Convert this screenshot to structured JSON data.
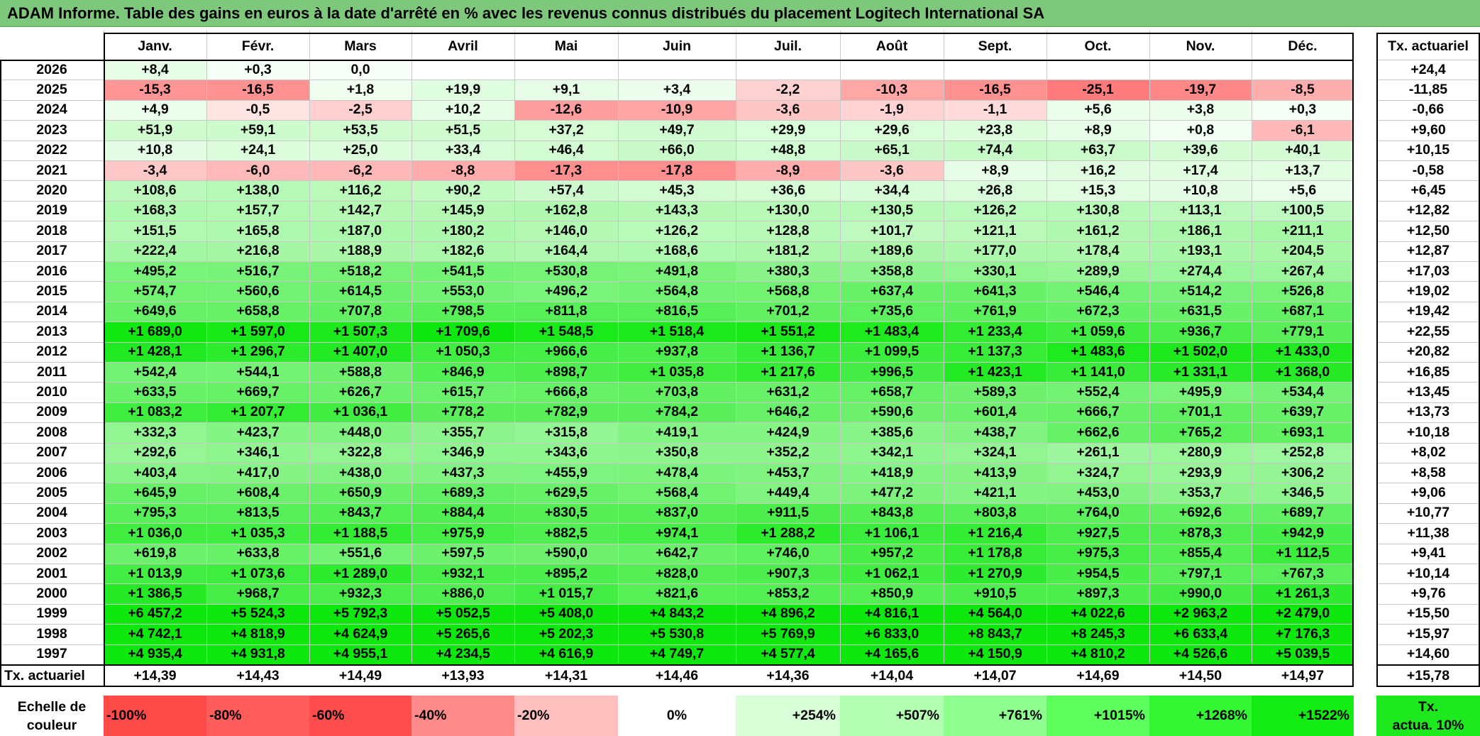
{
  "title": "ADAM Informe. Table des gains en euros à la date d'arrêté en % avec les revenus connus distribués du placement Logitech International SA",
  "months": [
    "Janv.",
    "Févr.",
    "Mars",
    "Avril",
    "Mai",
    "Juin",
    "Juil.",
    "Août",
    "Sept.",
    "Oct.",
    "Nov.",
    "Déc."
  ],
  "rate_header": "Tx. actuariel",
  "rows": [
    {
      "year": "2026",
      "values": [
        "+8,4",
        "+0,3",
        "0,0",
        "",
        "",
        "",
        "",
        "",
        "",
        "",
        "",
        ""
      ],
      "rate": "+24,4"
    },
    {
      "year": "2025",
      "values": [
        "-15,3",
        "-16,5",
        "+1,8",
        "+19,9",
        "+9,1",
        "+3,4",
        "-2,2",
        "-10,3",
        "-16,5",
        "-25,1",
        "-19,7",
        "-8,5"
      ],
      "rate": "-11,85"
    },
    {
      "year": "2024",
      "values": [
        "+4,9",
        "-0,5",
        "-2,5",
        "+10,2",
        "-12,6",
        "-10,9",
        "-3,6",
        "-1,9",
        "-1,1",
        "+5,6",
        "+3,8",
        "+0,3"
      ],
      "rate": "-0,66"
    },
    {
      "year": "2023",
      "values": [
        "+51,9",
        "+59,1",
        "+53,5",
        "+51,5",
        "+37,2",
        "+49,7",
        "+29,9",
        "+29,6",
        "+23,8",
        "+8,9",
        "+0,8",
        "-6,1"
      ],
      "rate": "+9,60"
    },
    {
      "year": "2022",
      "values": [
        "+10,8",
        "+24,1",
        "+25,0",
        "+33,4",
        "+46,4",
        "+66,0",
        "+48,8",
        "+65,1",
        "+74,4",
        "+63,7",
        "+39,6",
        "+40,1"
      ],
      "rate": "+10,15"
    },
    {
      "year": "2021",
      "values": [
        "-3,4",
        "-6,0",
        "-6,2",
        "-8,8",
        "-17,3",
        "-17,8",
        "-8,9",
        "-3,6",
        "+8,9",
        "+16,2",
        "+17,4",
        "+13,7"
      ],
      "rate": "-0,58"
    },
    {
      "year": "2020",
      "values": [
        "+108,6",
        "+138,0",
        "+116,2",
        "+90,2",
        "+57,4",
        "+45,3",
        "+36,6",
        "+34,4",
        "+26,8",
        "+15,3",
        "+10,8",
        "+5,6"
      ],
      "rate": "+6,45"
    },
    {
      "year": "2019",
      "values": [
        "+168,3",
        "+157,7",
        "+142,7",
        "+145,9",
        "+162,8",
        "+143,3",
        "+130,0",
        "+130,5",
        "+126,2",
        "+130,8",
        "+113,1",
        "+100,5"
      ],
      "rate": "+12,82"
    },
    {
      "year": "2018",
      "values": [
        "+151,5",
        "+165,8",
        "+187,0",
        "+180,2",
        "+146,0",
        "+126,2",
        "+128,8",
        "+101,7",
        "+121,1",
        "+161,2",
        "+186,1",
        "+211,1"
      ],
      "rate": "+12,50"
    },
    {
      "year": "2017",
      "values": [
        "+222,4",
        "+216,8",
        "+188,9",
        "+182,6",
        "+164,4",
        "+168,6",
        "+181,2",
        "+189,6",
        "+177,0",
        "+178,4",
        "+193,1",
        "+204,5"
      ],
      "rate": "+12,87"
    },
    {
      "year": "2016",
      "values": [
        "+495,2",
        "+516,7",
        "+518,2",
        "+541,5",
        "+530,8",
        "+491,8",
        "+380,3",
        "+358,8",
        "+330,1",
        "+289,9",
        "+274,4",
        "+267,4"
      ],
      "rate": "+17,03"
    },
    {
      "year": "2015",
      "values": [
        "+574,7",
        "+560,6",
        "+614,5",
        "+553,0",
        "+496,2",
        "+564,8",
        "+568,8",
        "+637,4",
        "+641,3",
        "+546,4",
        "+514,2",
        "+526,8"
      ],
      "rate": "+19,02"
    },
    {
      "year": "2014",
      "values": [
        "+649,6",
        "+658,8",
        "+707,8",
        "+798,5",
        "+811,8",
        "+816,5",
        "+701,2",
        "+735,6",
        "+761,9",
        "+672,3",
        "+631,5",
        "+687,1"
      ],
      "rate": "+19,42"
    },
    {
      "year": "2013",
      "values": [
        "+1 689,0",
        "+1 597,0",
        "+1 507,3",
        "+1 709,6",
        "+1 548,5",
        "+1 518,4",
        "+1 551,2",
        "+1 483,4",
        "+1 233,4",
        "+1 059,6",
        "+936,7",
        "+779,1"
      ],
      "rate": "+22,55"
    },
    {
      "year": "2012",
      "values": [
        "+1 428,1",
        "+1 296,7",
        "+1 407,0",
        "+1 050,3",
        "+966,6",
        "+937,8",
        "+1 136,7",
        "+1 099,5",
        "+1 137,3",
        "+1 483,6",
        "+1 502,0",
        "+1 433,0"
      ],
      "rate": "+20,82"
    },
    {
      "year": "2011",
      "values": [
        "+542,4",
        "+544,1",
        "+588,8",
        "+846,9",
        "+898,7",
        "+1 035,8",
        "+1 217,6",
        "+996,5",
        "+1 423,1",
        "+1 141,0",
        "+1 331,1",
        "+1 368,0"
      ],
      "rate": "+16,85"
    },
    {
      "year": "2010",
      "values": [
        "+633,5",
        "+669,7",
        "+626,7",
        "+615,7",
        "+666,8",
        "+703,8",
        "+631,2",
        "+658,7",
        "+589,3",
        "+552,4",
        "+495,9",
        "+534,4"
      ],
      "rate": "+13,45"
    },
    {
      "year": "2009",
      "values": [
        "+1 083,2",
        "+1 207,7",
        "+1 036,1",
        "+778,2",
        "+782,9",
        "+784,2",
        "+646,2",
        "+590,6",
        "+601,4",
        "+666,7",
        "+701,1",
        "+639,7"
      ],
      "rate": "+13,73"
    },
    {
      "year": "2008",
      "values": [
        "+332,3",
        "+423,7",
        "+448,0",
        "+355,7",
        "+315,8",
        "+419,1",
        "+424,9",
        "+385,6",
        "+438,7",
        "+662,6",
        "+765,2",
        "+693,1"
      ],
      "rate": "+10,18"
    },
    {
      "year": "2007",
      "values": [
        "+292,6",
        "+346,1",
        "+322,8",
        "+346,9",
        "+343,6",
        "+350,8",
        "+352,2",
        "+342,1",
        "+324,1",
        "+261,1",
        "+280,9",
        "+252,8"
      ],
      "rate": "+8,02"
    },
    {
      "year": "2006",
      "values": [
        "+403,4",
        "+417,0",
        "+438,0",
        "+437,3",
        "+455,9",
        "+478,4",
        "+453,7",
        "+418,9",
        "+413,9",
        "+324,7",
        "+293,9",
        "+306,2"
      ],
      "rate": "+8,58"
    },
    {
      "year": "2005",
      "values": [
        "+645,9",
        "+608,4",
        "+650,9",
        "+689,3",
        "+629,5",
        "+568,4",
        "+449,4",
        "+477,2",
        "+421,1",
        "+453,0",
        "+353,7",
        "+346,5"
      ],
      "rate": "+9,06"
    },
    {
      "year": "2004",
      "values": [
        "+795,3",
        "+813,5",
        "+843,7",
        "+884,4",
        "+830,5",
        "+837,0",
        "+911,5",
        "+843,8",
        "+803,8",
        "+764,0",
        "+692,6",
        "+689,7"
      ],
      "rate": "+10,77"
    },
    {
      "year": "2003",
      "values": [
        "+1 036,0",
        "+1 035,3",
        "+1 188,5",
        "+975,9",
        "+882,5",
        "+974,1",
        "+1 288,2",
        "+1 106,1",
        "+1 216,4",
        "+927,5",
        "+878,3",
        "+942,9"
      ],
      "rate": "+11,38"
    },
    {
      "year": "2002",
      "values": [
        "+619,8",
        "+633,8",
        "+551,6",
        "+597,5",
        "+590,0",
        "+642,7",
        "+746,0",
        "+957,2",
        "+1 178,8",
        "+975,3",
        "+855,4",
        "+1 112,5"
      ],
      "rate": "+9,41"
    },
    {
      "year": "2001",
      "values": [
        "+1 013,9",
        "+1 073,6",
        "+1 289,0",
        "+932,1",
        "+895,2",
        "+828,0",
        "+907,3",
        "+1 062,1",
        "+1 270,9",
        "+954,5",
        "+797,1",
        "+767,3"
      ],
      "rate": "+10,14"
    },
    {
      "year": "2000",
      "values": [
        "+1 386,5",
        "+968,7",
        "+932,3",
        "+886,0",
        "+1 015,7",
        "+821,6",
        "+853,2",
        "+850,9",
        "+910,5",
        "+897,3",
        "+990,0",
        "+1 261,3"
      ],
      "rate": "+9,76"
    },
    {
      "year": "1999",
      "values": [
        "+6 457,2",
        "+5 524,3",
        "+5 792,3",
        "+5 052,5",
        "+5 408,0",
        "+4 843,2",
        "+4 896,2",
        "+4 816,1",
        "+4 564,0",
        "+4 022,6",
        "+2 963,2",
        "+2 479,0"
      ],
      "rate": "+15,50"
    },
    {
      "year": "1998",
      "values": [
        "+4 742,1",
        "+4 818,9",
        "+4 624,9",
        "+5 265,6",
        "+5 202,3",
        "+5 530,8",
        "+5 769,9",
        "+6 833,0",
        "+8 843,7",
        "+8 245,3",
        "+6 633,4",
        "+7 176,3"
      ],
      "rate": "+15,97"
    },
    {
      "year": "1997",
      "values": [
        "+4 935,4",
        "+4 931,8",
        "+4 955,1",
        "+4 234,5",
        "+4 616,9",
        "+4 749,7",
        "+4 577,4",
        "+4 165,6",
        "+4 150,9",
        "+4 810,2",
        "+4 526,6",
        "+5 039,5"
      ],
      "rate": "+14,60"
    }
  ],
  "footer": {
    "label": "Tx. actuariel",
    "values": [
      "+14,39",
      "+14,43",
      "+14,49",
      "+13,93",
      "+14,31",
      "+14,46",
      "+14,36",
      "+14,04",
      "+14,07",
      "+14,69",
      "+14,50",
      "+14,97"
    ],
    "rate": "+15,78"
  },
  "scale": {
    "label_line1": "Echelle de",
    "label_line2": "couleur",
    "steps": [
      {
        "text": "-100%",
        "color": "#ff4a4a",
        "align": "left"
      },
      {
        "text": "-80%",
        "color": "#ff5c5c",
        "align": "left"
      },
      {
        "text": "-60%",
        "color": "#ff4d4d",
        "align": "left"
      },
      {
        "text": "-40%",
        "color": "#ff8a8a",
        "align": "left"
      },
      {
        "text": "-20%",
        "color": "#ffbfbf",
        "align": "left"
      },
      {
        "text": "0%",
        "color": "#ffffff",
        "align": "center"
      },
      {
        "text": "+254%",
        "color": "#d8ffd8",
        "align": "right"
      },
      {
        "text": "+507%",
        "color": "#b4ffb4",
        "align": "right"
      },
      {
        "text": "+761%",
        "color": "#8eff8e",
        "align": "right"
      },
      {
        "text": "+1015%",
        "color": "#5cff5c",
        "align": "right"
      },
      {
        "text": "+1268%",
        "color": "#33f733",
        "align": "right"
      },
      {
        "text": "+1522%",
        "color": "#12ec12",
        "align": "right"
      }
    ],
    "rate_line1": "Tx.",
    "rate_line2": "actua. 10%",
    "rate_color": "#1ee81e"
  },
  "colors": {
    "title_bar": "#7ec87c",
    "max_green": "#0fe80f",
    "max_red": "#ff6b6b"
  }
}
